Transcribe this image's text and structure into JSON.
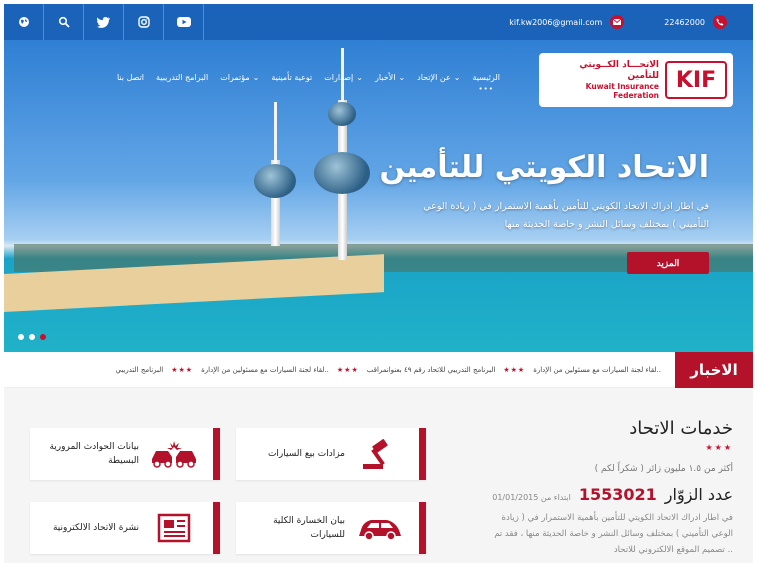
{
  "topbar": {
    "phone": "22462000",
    "email": "kif.kw2006@gmail.com",
    "social_icons": [
      "youtube-icon",
      "instagram-icon",
      "twitter-icon",
      "search-icon",
      "globe-icon"
    ]
  },
  "logo": {
    "mark": "KIF",
    "arabic": "الاتحـــاد الكــويتي للتأمين",
    "english": "Kuwait Insurance Federation"
  },
  "nav": {
    "items": [
      "الرئيسية",
      "عن الإتحاد",
      "الأخبار",
      "إصدارات",
      "توعية تأمينية",
      "مؤتمرات",
      "البرامج التدريبية",
      "اتصل بنا"
    ]
  },
  "hero": {
    "title": "الاتحاد الكويتي للتأمين",
    "description": "في اطار ادراك الاتحاد الكويتي للتأمين بأهمية الاستمرار في ( زيادة الوعي التأميني ) بمختلف وسائل النشر و خاصة الحديثة منها",
    "more_button": "المزيد"
  },
  "news": {
    "label": "الاخبار",
    "items": [
      "لقاء لجنة السيارات مع مسئولين من الإدارة..",
      "البرنامج التدريبي للاتحاد رقم ٤٩ بعنوانمراقب",
      "لقاء لجنة السيارات مع مسئولين من الإدارة..",
      "البرنامج التدريبي"
    ]
  },
  "services": {
    "title": "خدمات الاتحاد",
    "stars": "★★★",
    "visitors_line": "أكثر من ١.٥ مليون زائر ( شكراً لكم )",
    "count_label": "عدد الزوّار",
    "count_value": "1553021",
    "since_label": "ابتداء من 01/01/2015",
    "about": "في اطار ادراك الاتحاد الكويتي للتأمين بأهمية الاستمرار في ( زيادة الوعي التأميني ) بمختلف وسائل النشر و خاصة الحديثة منها ، فقد تم تصميم الموقع الالكتروني للاتحاد ..",
    "cards": [
      {
        "label": "مزادات بيع السيارات",
        "icon": "gavel-icon"
      },
      {
        "label": "بيانات الحوادث المرورية البسيطة",
        "icon": "car-crash-icon"
      },
      {
        "label": "بيان الخسارة الكلية للسيارات",
        "icon": "car-icon"
      },
      {
        "label": "نشرة الاتحاد الالكترونية",
        "icon": "newspaper-icon"
      }
    ]
  },
  "colors": {
    "brand_red": "#b3122a",
    "topbar_blue": "#1a63b8"
  }
}
